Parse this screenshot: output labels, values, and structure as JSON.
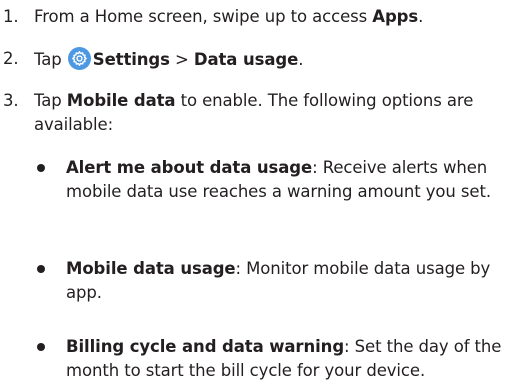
{
  "steps": [
    {
      "number": "1.",
      "text_before": "From a Home screen, swipe up to access ",
      "bold": "Apps",
      "text_after": "."
    },
    {
      "number": "2.",
      "text_before": "Tap ",
      "icon": "settings-gear-icon",
      "bold_1": "Settings",
      "separator": " > ",
      "bold_2": "Data usage",
      "text_after": "."
    },
    {
      "number": "3.",
      "text_before": "Tap ",
      "bold": "Mobile data",
      "text_after": " to enable. The following options are available:"
    }
  ],
  "options": [
    {
      "title": "Alert me about data usage",
      "description": ": Receive alerts when mobile data use reaches a warning amount you set."
    },
    {
      "title": "Mobile data usage",
      "description": ": Monitor mobile data usage by app."
    },
    {
      "title": "Billing cycle and data warning",
      "description": ": Set the day of the month to start the bill cycle for your device."
    }
  ],
  "colors": {
    "text": "#231f20",
    "settings_icon": "#4d98e3"
  }
}
